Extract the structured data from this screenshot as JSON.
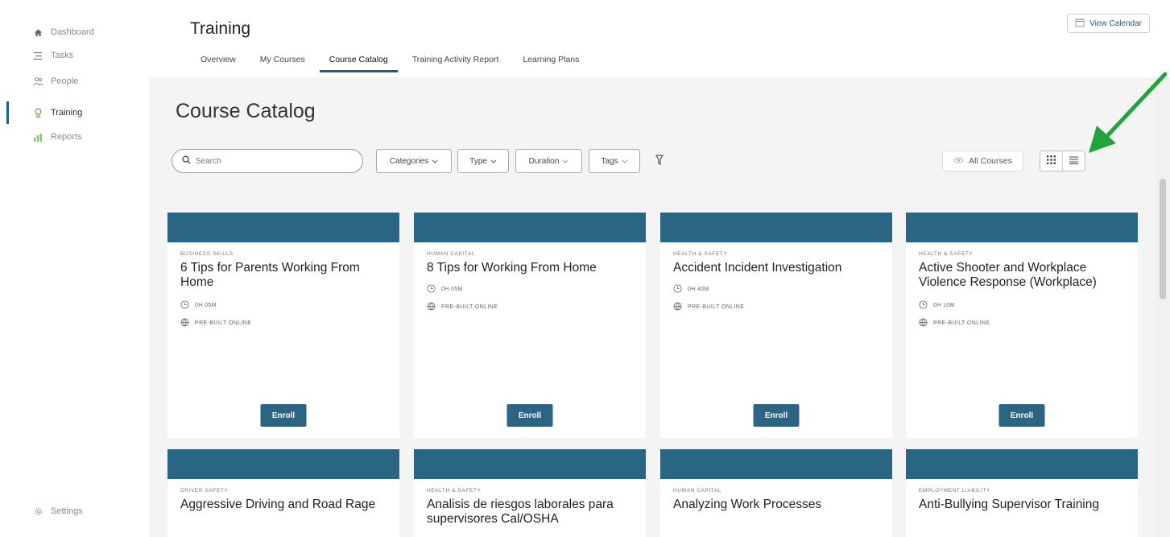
{
  "sidebar": {
    "items": [
      {
        "label": "Dashboard",
        "icon": "home-icon"
      },
      {
        "label": "Tasks",
        "icon": "tasks-icon"
      },
      {
        "label": "People",
        "icon": "people-icon"
      },
      {
        "label": "Training",
        "icon": "training-icon",
        "active": true
      },
      {
        "label": "Reports",
        "icon": "reports-icon"
      }
    ],
    "settings_label": "Settings"
  },
  "header": {
    "title": "Training",
    "view_calendar": "View Calendar",
    "tabs": [
      {
        "label": "Overview"
      },
      {
        "label": "My Courses"
      },
      {
        "label": "Course Catalog",
        "active": true
      },
      {
        "label": "Training Activity Report"
      },
      {
        "label": "Learning Plans"
      }
    ]
  },
  "catalog": {
    "title": "Course Catalog",
    "search_placeholder": "Search",
    "filters": [
      "Categories",
      "Type",
      "Duration",
      "Tags"
    ],
    "all_courses_label": "All Courses",
    "enroll_label": "Enroll",
    "cards": [
      {
        "category": "Business Skills",
        "title": "6 Tips for Parents Working From Home",
        "duration": "0H 05M",
        "type": "Pre-Built Online"
      },
      {
        "category": "Human Capital",
        "title": "8 Tips for Working From Home",
        "duration": "0H 05M",
        "type": "Pre-Built Online"
      },
      {
        "category": "Health & Safety",
        "title": "Accident Incident Investigation",
        "duration": "0H 40M",
        "type": "Pre-Built Online"
      },
      {
        "category": "Health & Safety",
        "title": "Active Shooter and Workplace Violence Response (Workplace)",
        "duration": "0H 10M",
        "type": "Pre-Built Online"
      },
      {
        "category": "Driver Safety",
        "title": "Aggressive Driving and Road Rage"
      },
      {
        "category": "Health & Safety",
        "title": "Analisis de riesgos laborales para supervisores Cal/OSHA"
      },
      {
        "category": "Human Capital",
        "title": "Analyzing Work Processes"
      },
      {
        "category": "Employment Liability",
        "title": "Anti-Bullying Supervisor Training"
      }
    ]
  },
  "colors": {
    "accent": "#2a6583",
    "active_tab_underline": "#1d5f7c",
    "annotation_arrow": "#22a33b"
  }
}
